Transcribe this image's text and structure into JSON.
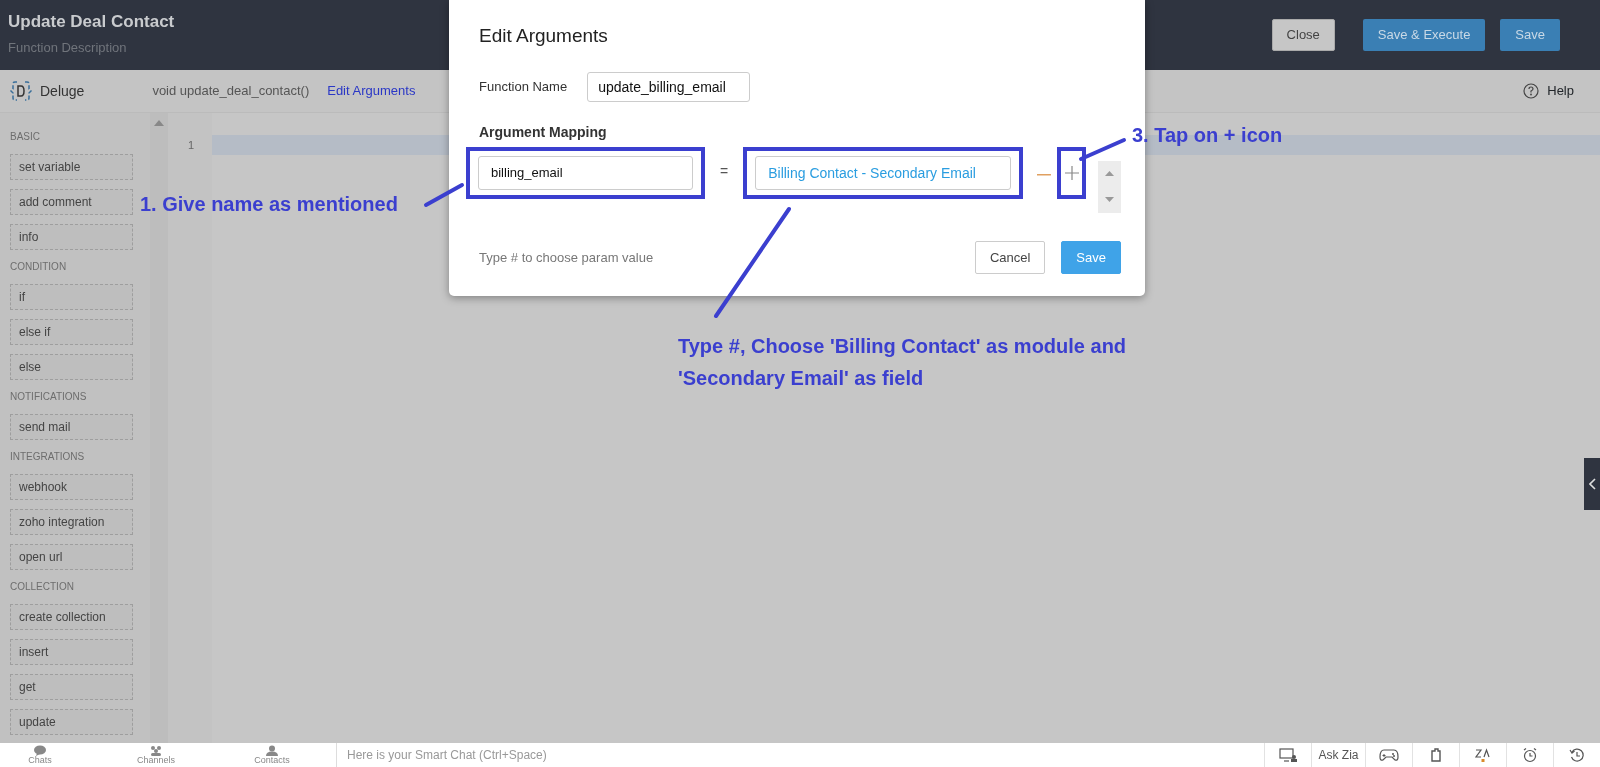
{
  "header": {
    "title": "Update Deal Contact",
    "subtitle": "Function Description",
    "buttons": [
      {
        "label": "Close",
        "kind": "secondary"
      },
      {
        "label": "Save & Execute",
        "kind": "primary"
      },
      {
        "label": "Save",
        "kind": "primary"
      }
    ]
  },
  "toolbar": {
    "language": "Deluge",
    "signature": "void update_deal_contact()",
    "link": "Edit Arguments",
    "help": "Help"
  },
  "sidebar": {
    "sections": [
      {
        "heading": "BASIC",
        "items": [
          "set variable",
          "add comment",
          "info"
        ]
      },
      {
        "heading": "CONDITION",
        "items": [
          "if",
          "else if",
          "else"
        ]
      },
      {
        "heading": "NOTIFICATIONS",
        "items": [
          "send mail"
        ]
      },
      {
        "heading": "INTEGRATIONS",
        "items": [
          "webhook",
          "zoho integration",
          "open url"
        ]
      },
      {
        "heading": "COLLECTION",
        "items": [
          "create collection",
          "insert",
          "get",
          "update"
        ]
      }
    ]
  },
  "editor": {
    "line_numbers": [
      "1"
    ]
  },
  "dialog": {
    "title": "Edit Arguments",
    "function_name_label": "Function Name",
    "function_name": "update_billing_email",
    "mapping_label": "Argument Mapping",
    "mappings": [
      {
        "name": "billing_email",
        "equals": "=",
        "value": "Billing Contact - Secondary Email"
      }
    ],
    "hint": "Type # to choose param value",
    "buttons": [
      {
        "label": "Cancel",
        "kind": "secondary"
      },
      {
        "label": "Save",
        "kind": "primary"
      }
    ]
  },
  "annotations": [
    {
      "text": "1. Give name as mentioned"
    },
    {
      "text": "3. Tap on + icon"
    },
    {
      "text": "Type #, Choose 'Billing Contact' as module and 'Secondary Email' as field"
    }
  ],
  "bottom_bar": {
    "tabs": [
      "Chats",
      "Channels",
      "Contacts"
    ],
    "chat_placeholder": "Here is your Smart Chat (Ctrl+Space)",
    "ask_zia": "Ask Zia"
  }
}
